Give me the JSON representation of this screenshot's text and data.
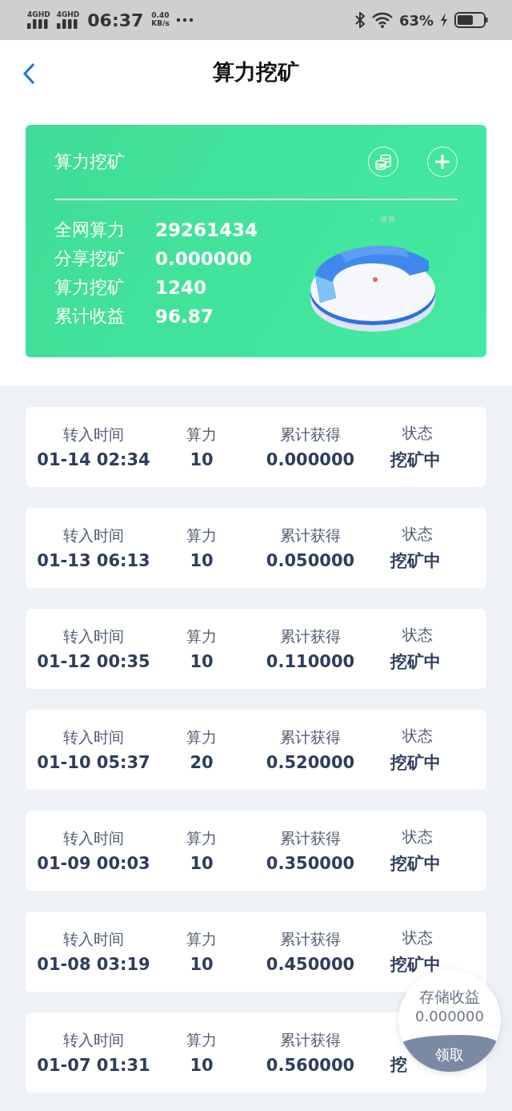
{
  "status_bar": {
    "sim_1": "4GHD",
    "sim_2": "4GHD",
    "time": "06:37",
    "speed": "0.40",
    "speed_unit": "KB/s",
    "battery": "63%"
  },
  "header": {
    "title": "算力挖矿"
  },
  "summary_card": {
    "title": "算力挖矿",
    "stats": [
      {
        "label": "全网算力",
        "value": "29261434"
      },
      {
        "label": "分享挖矿",
        "value": "0.000000"
      },
      {
        "label": "算力挖矿",
        "value": "1240"
      },
      {
        "label": "累计收益",
        "value": "96.87"
      }
    ]
  },
  "records": [
    {
      "time_label": "转入时间",
      "time": "01-14 02:34",
      "power_label": "算力",
      "power": "10",
      "earned_label": "累计获得",
      "earned": "0.000000",
      "status_label": "状态",
      "status": "挖矿中"
    },
    {
      "time_label": "转入时间",
      "time": "01-13 06:13",
      "power_label": "算力",
      "power": "10",
      "earned_label": "累计获得",
      "earned": "0.050000",
      "status_label": "状态",
      "status": "挖矿中"
    },
    {
      "time_label": "转入时间",
      "time": "01-12 00:35",
      "power_label": "算力",
      "power": "10",
      "earned_label": "累计获得",
      "earned": "0.110000",
      "status_label": "状态",
      "status": "挖矿中"
    },
    {
      "time_label": "转入时间",
      "time": "01-10 05:37",
      "power_label": "算力",
      "power": "20",
      "earned_label": "累计获得",
      "earned": "0.520000",
      "status_label": "状态",
      "status": "挖矿中"
    },
    {
      "time_label": "转入时间",
      "time": "01-09 00:03",
      "power_label": "算力",
      "power": "10",
      "earned_label": "累计获得",
      "earned": "0.350000",
      "status_label": "状态",
      "status": "挖矿中"
    },
    {
      "time_label": "转入时间",
      "time": "01-08 03:19",
      "power_label": "算力",
      "power": "10",
      "earned_label": "累计获得",
      "earned": "0.450000",
      "status_label": "状态",
      "status": "挖矿中"
    },
    {
      "time_label": "转入时间",
      "time": "01-07 01:31",
      "power_label": "算力",
      "power": "10",
      "earned_label": "累计获得",
      "earned": "0.560000",
      "status": "挖"
    }
  ],
  "floating_bubble": {
    "label": "存储收益",
    "value": "0.000000",
    "action": "领取"
  }
}
